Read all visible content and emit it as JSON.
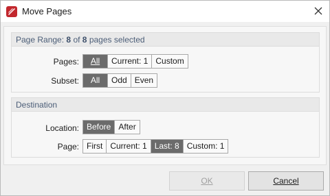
{
  "window": {
    "title": "Move Pages",
    "icon": "pdf-app-icon",
    "close_icon": "close-icon"
  },
  "page_range": {
    "title_prefix": "Page Range:",
    "selected": "8",
    "of_text": "of",
    "total": "8",
    "suffix": "pages selected",
    "pages": {
      "label": "Pages:",
      "options": [
        "All",
        "Current: 1",
        "Custom"
      ],
      "selected_index": 0
    },
    "subset": {
      "label": "Subset:",
      "options": [
        "All",
        "Odd",
        "Even"
      ],
      "selected_index": 0
    }
  },
  "destination": {
    "title": "Destination",
    "location": {
      "label": "Location:",
      "options": [
        "Before",
        "After"
      ],
      "selected_index": 0
    },
    "page": {
      "label": "Page:",
      "options": [
        "First",
        "Current: 1",
        "Last: 8",
        "Custom: 1"
      ],
      "selected_index": 2
    }
  },
  "buttons": {
    "ok": "OK",
    "cancel": "Cancel"
  },
  "colors": {
    "selected_segment": "#6b6b6b",
    "group_title": "#4b5d77",
    "app_icon": "#c2272d"
  }
}
